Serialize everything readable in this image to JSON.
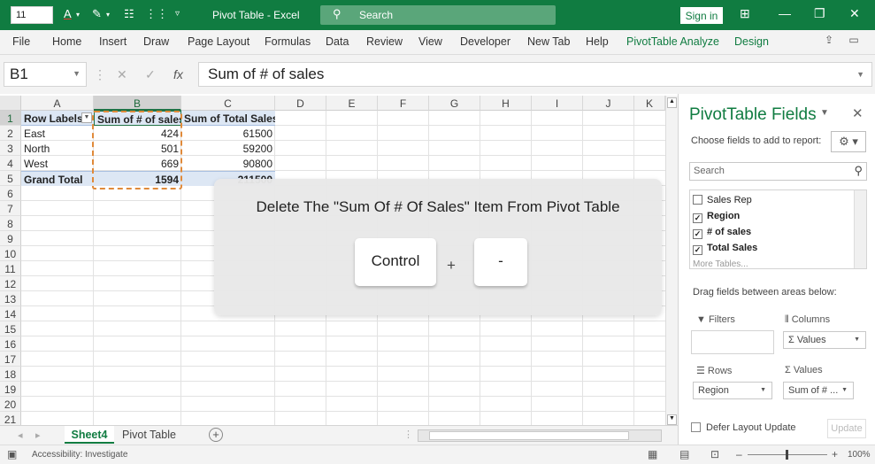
{
  "titlebar": {
    "font_size": "11",
    "title": "Pivot Table  -  Excel",
    "search_placeholder": "Search",
    "sign_in": "Sign in"
  },
  "ribbon_tabs": [
    "File",
    "Home",
    "Insert",
    "Draw",
    "Page Layout",
    "Formulas",
    "Data",
    "Review",
    "View",
    "Developer",
    "New Tab",
    "Help",
    "PivotTable Analyze",
    "Design"
  ],
  "formula_bar": {
    "name_box": "B1",
    "formula": "Sum of # of sales",
    "fx": "fx"
  },
  "grid": {
    "columns": [
      "A",
      "B",
      "C",
      "D",
      "E",
      "F",
      "G",
      "H",
      "I",
      "J",
      "K"
    ],
    "rows": [
      "1",
      "2",
      "3",
      "4",
      "5",
      "6",
      "7",
      "8",
      "9",
      "10",
      "11",
      "12",
      "13",
      "14",
      "15",
      "16",
      "17",
      "18",
      "19",
      "20",
      "21"
    ],
    "pivot": {
      "headers": [
        "Row Labels",
        "Sum of # of sales",
        "Sum of Total Sales"
      ],
      "rows": [
        [
          "East",
          "424",
          "61500"
        ],
        [
          "North",
          "501",
          "59200"
        ],
        [
          "West",
          "669",
          "90800"
        ]
      ],
      "total": [
        "Grand Total",
        "1594",
        "211500"
      ]
    }
  },
  "sheets": {
    "active": "Sheet4",
    "other": "Pivot Table",
    "add": "+"
  },
  "statusbar": {
    "accessibility": "Accessibility: Investigate",
    "zoom": "100%",
    "zoom_minus": "–",
    "zoom_plus": "+"
  },
  "pivot_pane": {
    "title": "PivotTable Fields",
    "choose_label": "Choose fields to add to report:",
    "search_placeholder": "Search",
    "fields": [
      {
        "label": "Sales Rep",
        "checked": false
      },
      {
        "label": "Region",
        "checked": true
      },
      {
        "label": "# of sales",
        "checked": true
      },
      {
        "label": "Total Sales",
        "checked": true
      }
    ],
    "more_tables": "More Tables...",
    "drag_label": "Drag fields between areas below:",
    "areas": {
      "filters": "Filters",
      "columns": "Columns",
      "columns_item": "Σ Values",
      "rows": "Rows",
      "rows_item": "Region",
      "values": "Values",
      "values_item": "Sum of # ..."
    },
    "defer": "Defer Layout Update",
    "update": "Update"
  },
  "overlay": {
    "instruction": "Delete The \"Sum Of # Of Sales\" Item From Pivot Table",
    "key1": "Control",
    "plus": "+",
    "key2": "-"
  },
  "colors": {
    "excel_green": "#107c41",
    "pivot_header": "#dde7f4",
    "marquee": "#e08a3a"
  }
}
